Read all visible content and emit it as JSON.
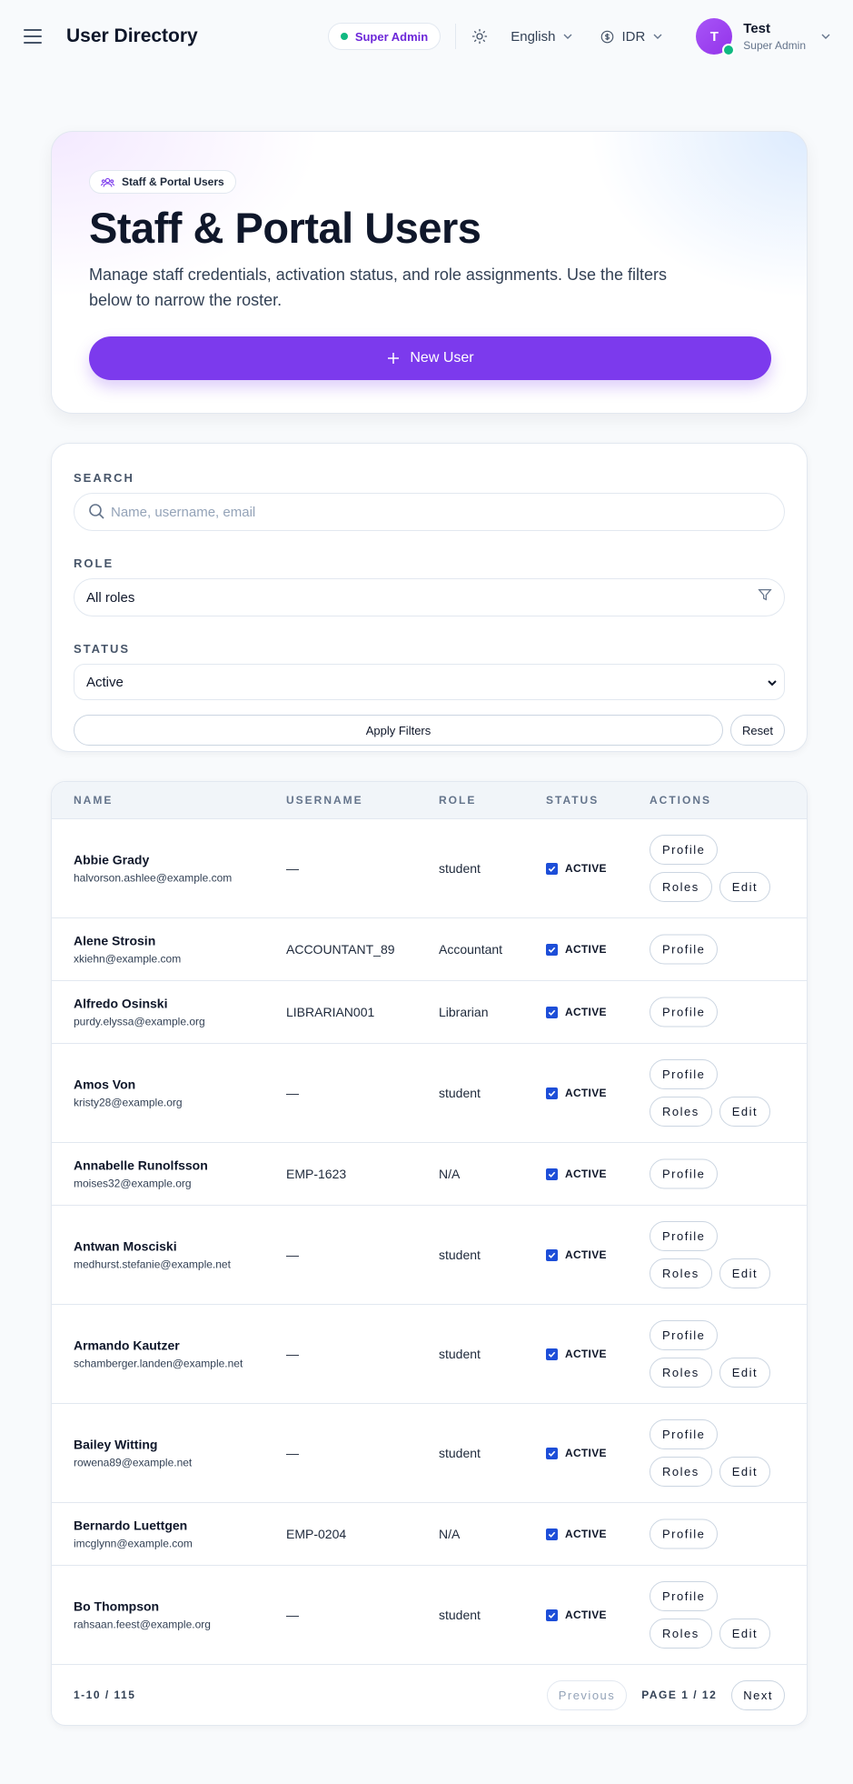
{
  "header": {
    "title": "User Directory",
    "role_badge": "Super Admin",
    "language": "English",
    "currency": "IDR",
    "user": {
      "initial": "T",
      "name": "Test",
      "role": "Super Admin"
    }
  },
  "hero": {
    "badge": "Staff & Portal Users",
    "title": "Staff & Portal Users",
    "description": "Manage staff credentials, activation status, and role assignments. Use the filters below to narrow the roster.",
    "new_user_label": "New User"
  },
  "filters": {
    "search_label": "SEARCH",
    "search_placeholder": "Name, username, email",
    "role_label": "ROLE",
    "role_value": "All roles",
    "status_label": "STATUS",
    "status_value": "Active",
    "apply_label": "Apply Filters",
    "reset_label": "Reset"
  },
  "table": {
    "columns": [
      "NAME",
      "USERNAME",
      "ROLE",
      "STATUS",
      "ACTIONS"
    ],
    "rows": [
      {
        "name": "Abbie Grady",
        "email": "halvorson.ashlee@example.com",
        "username": "—",
        "role": "student",
        "status": "ACTIVE",
        "actions": [
          "Profile",
          "Roles",
          "Edit"
        ]
      },
      {
        "name": "Alene Strosin",
        "email": "xkiehn@example.com",
        "username": "ACCOUNTANT_89",
        "role": "Accountant",
        "status": "ACTIVE",
        "actions": [
          "Profile"
        ]
      },
      {
        "name": "Alfredo Osinski",
        "email": "purdy.elyssa@example.org",
        "username": "LIBRARIAN001",
        "role": "Librarian",
        "status": "ACTIVE",
        "actions": [
          "Profile"
        ]
      },
      {
        "name": "Amos Von",
        "email": "kristy28@example.org",
        "username": "—",
        "role": "student",
        "status": "ACTIVE",
        "actions": [
          "Profile",
          "Roles",
          "Edit"
        ]
      },
      {
        "name": "Annabelle Runolfsson",
        "email": "moises32@example.org",
        "username": "EMP-1623",
        "role": "N/A",
        "status": "ACTIVE",
        "actions": [
          "Profile"
        ]
      },
      {
        "name": "Antwan Mosciski",
        "email": "medhurst.stefanie@example.net",
        "username": "—",
        "role": "student",
        "status": "ACTIVE",
        "actions": [
          "Profile",
          "Roles",
          "Edit"
        ]
      },
      {
        "name": "Armando Kautzer",
        "email": "schamberger.landen@example.net",
        "username": "—",
        "role": "student",
        "status": "ACTIVE",
        "actions": [
          "Profile",
          "Roles",
          "Edit"
        ]
      },
      {
        "name": "Bailey Witting",
        "email": "rowena89@example.net",
        "username": "—",
        "role": "student",
        "status": "ACTIVE",
        "actions": [
          "Profile",
          "Roles",
          "Edit"
        ]
      },
      {
        "name": "Bernardo Luettgen",
        "email": "imcglynn@example.com",
        "username": "EMP-0204",
        "role": "N/A",
        "status": "ACTIVE",
        "actions": [
          "Profile"
        ]
      },
      {
        "name": "Bo Thompson",
        "email": "rahsaan.feest@example.org",
        "username": "—",
        "role": "student",
        "status": "ACTIVE",
        "actions": [
          "Profile",
          "Roles",
          "Edit"
        ]
      }
    ]
  },
  "pagination": {
    "range": "1-10 / 115",
    "previous_label": "Previous",
    "page_indicator": "PAGE 1 / 12",
    "next_label": "Next"
  },
  "colors": {
    "accent": "#7c3aed",
    "online": "#10b981",
    "checkbox": "#1d4ed8"
  },
  "icons": {
    "menu": "hamburger-icon",
    "theme": "sun-icon",
    "currency": "coin-icon",
    "search": "search-icon",
    "filter": "filter-icon",
    "badge": "users-icon",
    "add": "plus-icon"
  }
}
